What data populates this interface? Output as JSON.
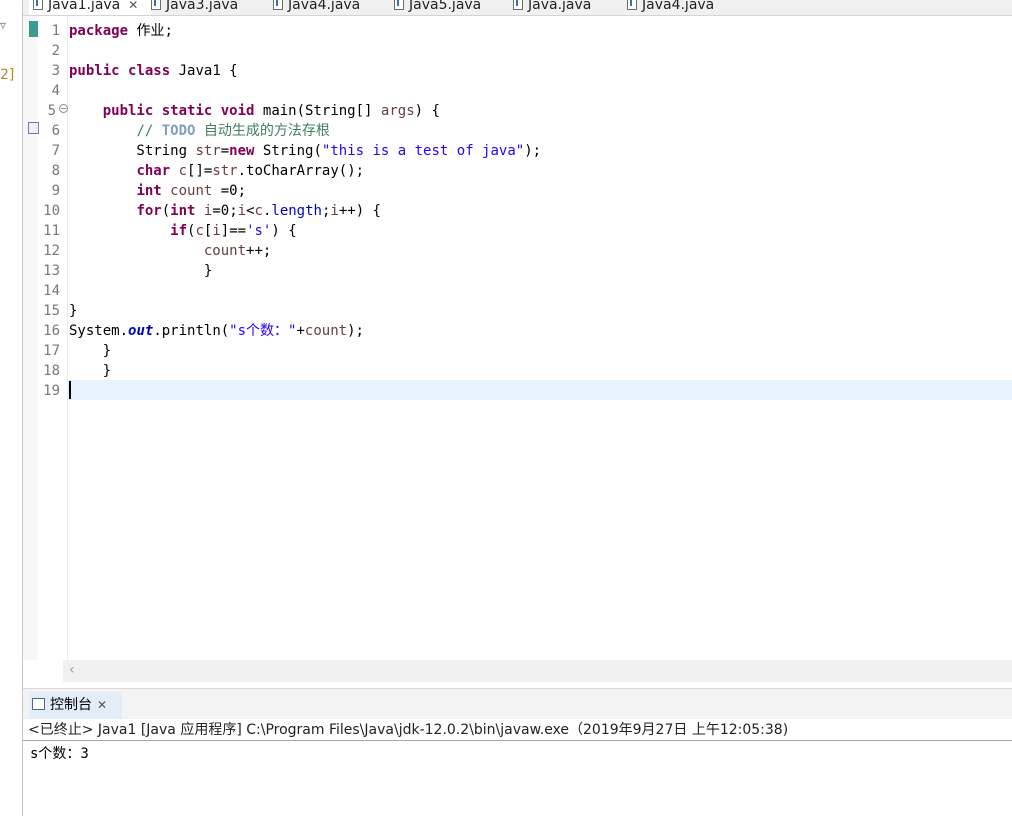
{
  "left_strip": {
    "glyph_top": "▿",
    "fragment": "2]"
  },
  "tabs": [
    {
      "label": "Java1.java",
      "active": true,
      "closable": true
    },
    {
      "label": "Java3.java"
    },
    {
      "label": "Java4.java"
    },
    {
      "label": "Java5.java"
    },
    {
      "label": "Java.java"
    },
    {
      "label": "Java4.java"
    }
  ],
  "editor": {
    "line_numbers": [
      "1",
      "2",
      "3",
      "4",
      "5",
      "6",
      "7",
      "8",
      "9",
      "10",
      "11",
      "12",
      "13",
      "14",
      "15",
      "16",
      "17",
      "18",
      "19"
    ],
    "lines": [
      "package 作业;",
      "",
      "public class Java1 {",
      "",
      "    public static void main(String[] args) {",
      "        // TODO 自动生成的方法存根",
      "        String str=new String(\"this is a test of java\");",
      "        char c[]=str.toCharArray();",
      "        int count =0;",
      "        for(int i=0;i<c.length;i++) {",
      "            if(c[i]=='s') {",
      "                count++;",
      "                }",
      "",
      "}",
      "System.out.println(\"s个数：\"+count);",
      "    }",
      "    }",
      ""
    ],
    "current_line": 19
  },
  "console": {
    "tab_label": "控制台",
    "header": "<已终止> Java1 [Java 应用程序] C:\\Program Files\\Java\\jdk-12.0.2\\bin\\javaw.exe（2019年9月27日 上午12:05:38)",
    "output": "s个数：3"
  },
  "colors": {
    "keyword": "#7f0055",
    "string": "#2a00ff",
    "comment": "#3f7f5f",
    "current_line_bg": "#e8f2fe"
  }
}
